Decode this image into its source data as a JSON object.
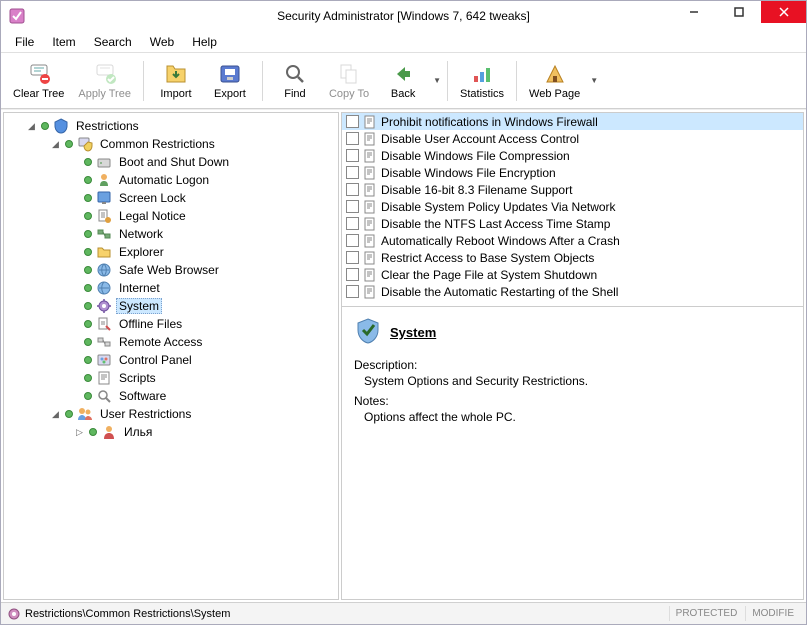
{
  "window": {
    "title": "Security Administrator [Windows 7, 642 tweaks]"
  },
  "menu": {
    "file": "File",
    "item": "Item",
    "search": "Search",
    "web": "Web",
    "help": "Help"
  },
  "toolbar": {
    "clear_tree": "Clear Tree",
    "apply_tree": "Apply Tree",
    "import": "Import",
    "export": "Export",
    "find": "Find",
    "copy_to": "Copy To",
    "back": "Back",
    "statistics": "Statistics",
    "web_page": "Web Page"
  },
  "tree": {
    "root": "Restrictions",
    "common": "Common Restrictions",
    "common_children": [
      "Boot and Shut Down",
      "Automatic Logon",
      "Screen Lock",
      "Legal Notice",
      "Network",
      "Explorer",
      "Safe Web Browser",
      "Internet",
      "System",
      "Offline Files",
      "Remote Access",
      "Control Panel",
      "Scripts",
      "Software"
    ],
    "selected_index": 8,
    "user_restrictions": "User Restrictions",
    "user_child": "Илья"
  },
  "list": {
    "items": [
      "Prohibit notifications in Windows Firewall",
      "Disable User Account Access Control",
      "Disable Windows File Compression",
      "Disable Windows File Encryption",
      "Disable 16-bit 8.3 Filename Support",
      "Disable System Policy Updates Via Network",
      "Disable the NTFS Last Access Time Stamp",
      "Automatically Reboot Windows After a Crash",
      "Restrict Access to Base System Objects",
      "Clear the Page File at System Shutdown",
      "Disable the Automatic Restarting of the Shell"
    ],
    "highlighted_index": 0
  },
  "detail": {
    "title": "System",
    "description_label": "Description:",
    "description_text": "System Options and Security Restrictions.",
    "notes_label": "Notes:",
    "notes_text": "Options affect the whole PC."
  },
  "statusbar": {
    "path": "Restrictions\\Common Restrictions\\System",
    "protected": "PROTECTED",
    "modified": "MODIFIE"
  }
}
